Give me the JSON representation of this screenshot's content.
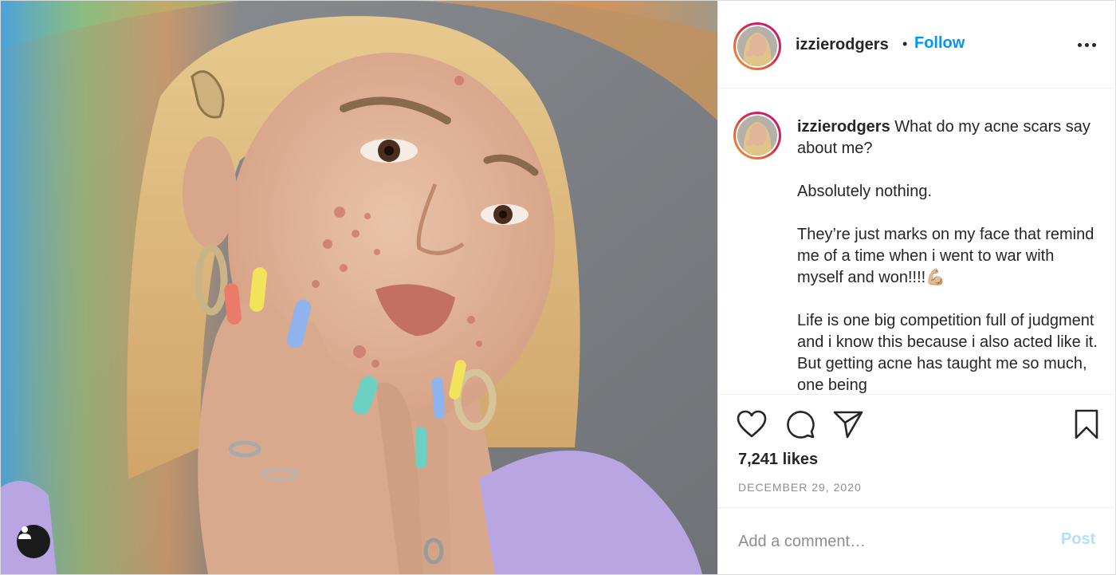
{
  "post": {
    "username": "izzierodgers",
    "follow_separator": "•",
    "follow_label": "Follow",
    "caption_lead": "What do my acne scars say about me?",
    "caption_paragraphs": [
      "Absolutely nothing.",
      "They’re just marks on my face that remind me of a time when i went to war with myself and won!!!!💪🏼",
      "Life is one big competition full of judgment and i know this because i also acted like it. But getting acne has taught me so much, one being"
    ],
    "likes": "7,241 likes",
    "date": "DECEMBER 29, 2020"
  },
  "comment": {
    "placeholder": "Add a comment…",
    "post_label": "Post"
  },
  "colors": {
    "accent": "#0095f6",
    "post_disabled": "#b2dffc",
    "muted": "#8e8e8e",
    "text": "#262626"
  },
  "icons": {
    "like": "heart-icon",
    "comment": "comment-icon",
    "share": "paper-plane-icon",
    "save": "bookmark-icon",
    "more": "more-options-icon",
    "user_tags": "user-icon"
  }
}
